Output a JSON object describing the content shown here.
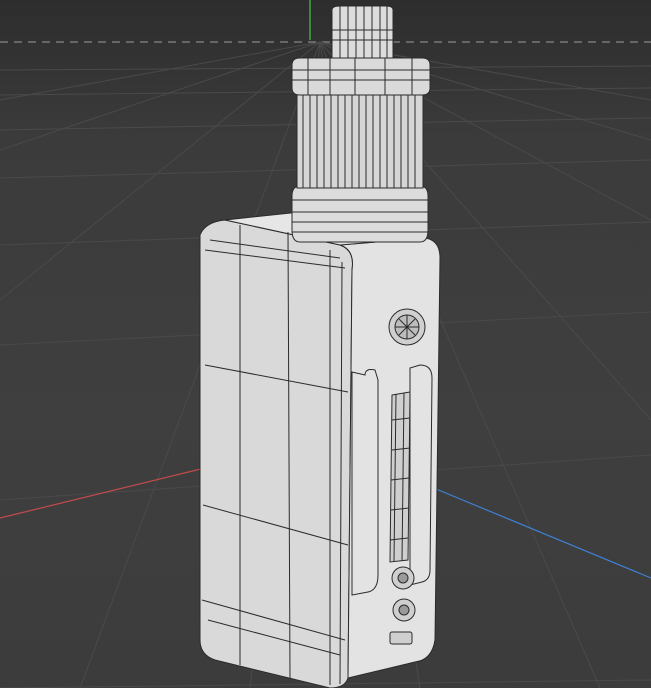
{
  "viewport": {
    "background": "#3c3c3c",
    "grid_color": "#4a4a4a",
    "axis_x_color": "#c44b4b",
    "axis_y_color": "#4bc44b",
    "axis_z_color": "#3f7fd1",
    "horizon_color": "#9a9a9a"
  },
  "model": {
    "description_icon": "vape-mod-wireframe-icon",
    "fill": "#d9d9d9",
    "wire": "#2b2b2b"
  }
}
